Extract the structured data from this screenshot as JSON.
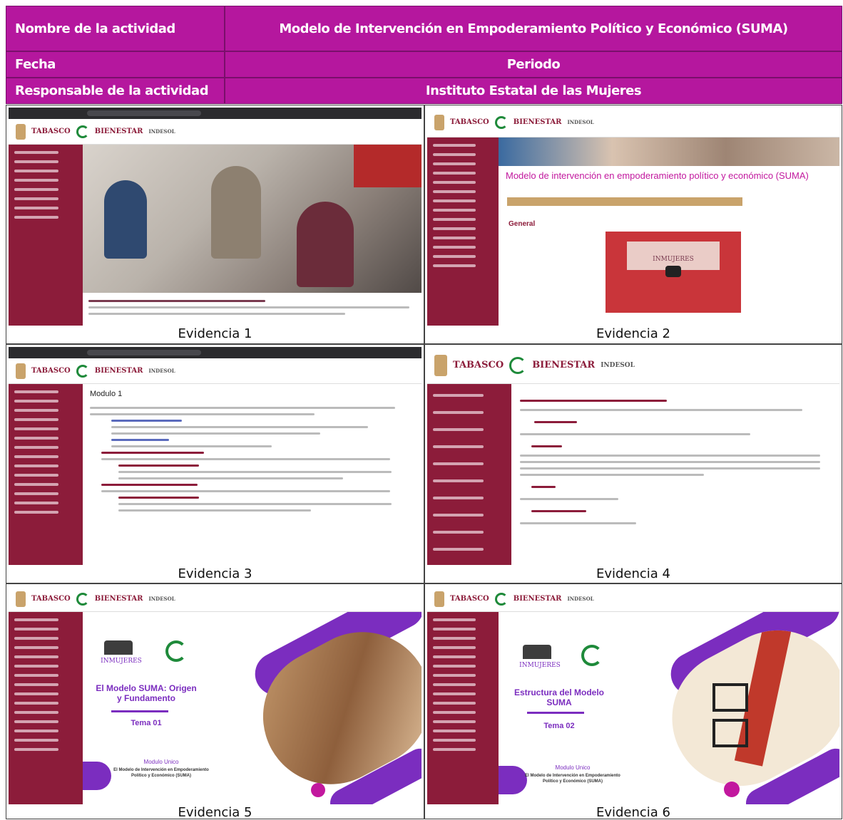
{
  "header": {
    "activity_name_label": "Nombre de la actividad",
    "activity_name_value": "Modelo de Intervención en Empoderamiento Político y Económico (SUMA)",
    "date_label": "Fecha",
    "date_value": "Periodo",
    "responsible_label": "Responsable de la actividad",
    "responsible_value": "Instituto Estatal de las Mujeres"
  },
  "evidences": {
    "e1": {
      "caption": "Evidencia 1"
    },
    "e2": {
      "caption": "Evidencia 2",
      "course_title": "Modelo de intervención en empoderamiento político y económico (SUMA)",
      "section": "General",
      "video_brand": "INMUJERES"
    },
    "e3": {
      "caption": "Evidencia 3",
      "module_title": "Modulo 1"
    },
    "e4": {
      "caption": "Evidencia 4"
    },
    "e5": {
      "caption": "Evidencia 5",
      "brand": "INMUJERES",
      "slide_title": "El Modelo SUMA: Origen y Fundamento",
      "topic": "Tema 01",
      "footer_title": "Modulo Unico",
      "footer_sub": "El Modelo de Intervención en Empoderamiento Político y Económico (SUMA)"
    },
    "e6": {
      "caption": "Evidencia 6",
      "brand": "INMUJERES",
      "slide_title": "Estructura del Modelo SUMA",
      "topic": "Tema 02",
      "footer_title": "Modulo Unico",
      "footer_sub": "El Modelo de Intervención en Empoderamiento Político y Económico (SUMA)"
    }
  },
  "logos": {
    "tabasco": "TABASCO",
    "bienestar": "BIENESTAR",
    "indesol": "INDESOL"
  },
  "colors": {
    "header_magenta": "#b5179e",
    "sidebar_maroon": "#8c1c3a",
    "slide_purple": "#7b2dbf"
  }
}
